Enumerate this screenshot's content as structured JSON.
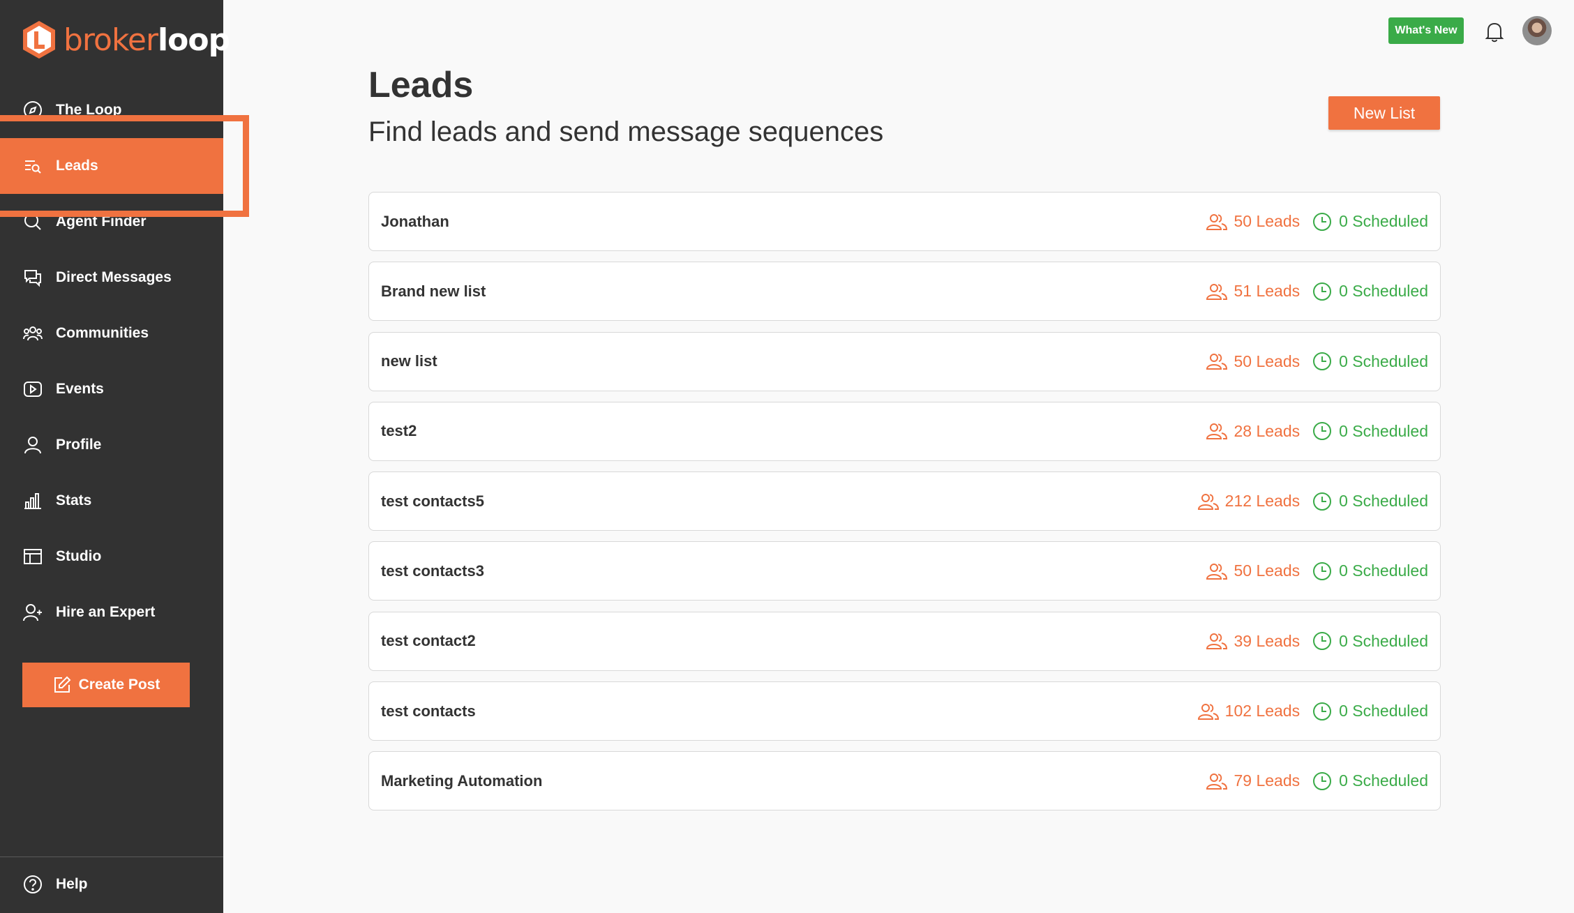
{
  "brand": {
    "name_part1": "broker",
    "name_part2": "loop",
    "accent": "#f07240"
  },
  "sidebar": {
    "items": [
      {
        "label": "The Loop",
        "icon": "compass-icon"
      },
      {
        "label": "Leads",
        "icon": "search-list-icon",
        "active": true
      },
      {
        "label": "Agent Finder",
        "icon": "search-icon"
      },
      {
        "label": "Direct Messages",
        "icon": "chat-icon"
      },
      {
        "label": "Communities",
        "icon": "people-icon"
      },
      {
        "label": "Events",
        "icon": "play-icon"
      },
      {
        "label": "Profile",
        "icon": "user-icon"
      },
      {
        "label": "Stats",
        "icon": "bar-chart-icon"
      },
      {
        "label": "Studio",
        "icon": "layout-icon"
      },
      {
        "label": "Hire an Expert",
        "icon": "user-plus-icon"
      }
    ],
    "create_post_label": "Create Post",
    "help_label": "Help"
  },
  "topbar": {
    "whats_new_label": "What's New",
    "whats_new_color": "#3aab48"
  },
  "main": {
    "title": "Leads",
    "subtitle": "Find leads and send message sequences",
    "new_list_label": "New List",
    "lists": [
      {
        "name": "Jonathan",
        "leads": "50 Leads",
        "scheduled": "0 Scheduled"
      },
      {
        "name": "Brand new list",
        "leads": "51 Leads",
        "scheduled": "0 Scheduled"
      },
      {
        "name": "new list",
        "leads": "50 Leads",
        "scheduled": "0 Scheduled"
      },
      {
        "name": "test2",
        "leads": "28 Leads",
        "scheduled": "0 Scheduled"
      },
      {
        "name": "test contacts5",
        "leads": "212 Leads",
        "scheduled": "0 Scheduled"
      },
      {
        "name": "test contacts3",
        "leads": "50 Leads",
        "scheduled": "0 Scheduled"
      },
      {
        "name": "test contact2",
        "leads": "39 Leads",
        "scheduled": "0 Scheduled"
      },
      {
        "name": "test contacts",
        "leads": "102 Leads",
        "scheduled": "0 Scheduled"
      },
      {
        "name": "Marketing Automation",
        "leads": "79 Leads",
        "scheduled": "0 Scheduled"
      }
    ]
  }
}
